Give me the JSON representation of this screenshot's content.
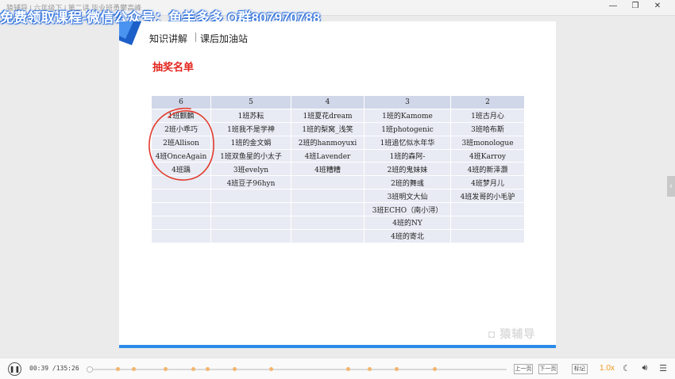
{
  "titlebar": {
    "breadcrumb": "猿辅导 | 六年级下 | 第二讲 毕业班勇攀高峰 ...",
    "minimize": "—",
    "maximize": "❐",
    "close": "✕"
  },
  "watermark": "免费领取课程-微信公众号：鱼羊多多 Q群807970788",
  "slide": {
    "tab_1": "知识讲解",
    "tab_2": "课后加油站",
    "title": "抽奖名单",
    "brand_watermark": "猿辅导",
    "table": {
      "headers": [
        "6",
        "5",
        "4",
        "3",
        "2"
      ],
      "rows": [
        [
          "1班麒麟",
          "1班苏耘",
          "1班夏花dream",
          "1班的Kamome",
          "1班古月心"
        ],
        [
          "2班小乖巧",
          "1班我不是学神",
          "1班的梨窝_浅笑",
          "1班photogenic",
          "3班哈布斯"
        ],
        [
          "2班Allison",
          "1班的金文娟",
          "2班的hanmoyuxi",
          "1班追忆似水年华",
          "3班monologue"
        ],
        [
          "4班OnceAgain",
          "1班双鱼星的小太子",
          "4班Lavender",
          "1班的森阿-",
          "4班Karroy"
        ],
        [
          "4班踽",
          "3班evelyn",
          "4班糟糟",
          "2班的鬼妹妹",
          "4班的新泽灏"
        ],
        [
          "",
          "4班豆子96hyn",
          "",
          "2班的舞彧",
          "4班梦月儿"
        ],
        [
          "",
          "",
          "",
          "3班明文大仙",
          "4班发哥的小毛驴"
        ],
        [
          "",
          "",
          "",
          "3班ECHO（南小浔）",
          ""
        ],
        [
          "",
          "",
          "",
          "4班的NY",
          ""
        ],
        [
          "",
          "",
          "",
          "4班的寄北",
          ""
        ]
      ]
    }
  },
  "player": {
    "play_icon": "pause-icon",
    "current_time": "00:39",
    "total_time": "135:26",
    "progress_fraction": 0.005,
    "prev_page": "上一页",
    "next_page": "下一页",
    "bookmark": "标记",
    "speed": "1.0x"
  },
  "colors": {
    "accent": "#2b8ae8",
    "title_red": "#e2261f",
    "speed_orange": "#f39a1d",
    "table_header": "#d0d7e8",
    "table_cell": "#e8ebf3"
  }
}
